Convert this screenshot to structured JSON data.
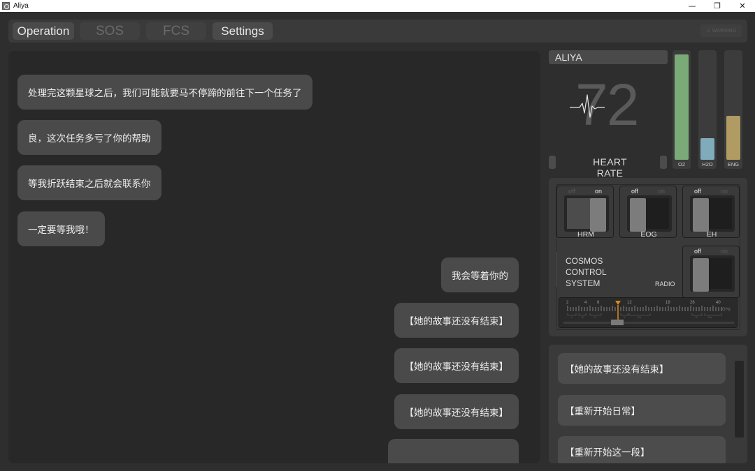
{
  "window": {
    "title": "Aliya",
    "controls": {
      "minimize": "—",
      "restore": "❐",
      "close": "✕"
    }
  },
  "toolbar": {
    "tabs": [
      {
        "label": "Operation",
        "state": "active"
      },
      {
        "label": "SOS",
        "state": "disabled"
      },
      {
        "label": "FCS",
        "state": "disabled"
      },
      {
        "label": "Settings",
        "state": "active"
      }
    ],
    "warning_badge": "⚠ WARNING"
  },
  "chat": {
    "messages": [
      {
        "from": "aliya",
        "text": "处理完这颗星球之后，我们可能就要马不停蹄的前往下一个任务了"
      },
      {
        "from": "aliya",
        "text": "良，这次任务多亏了你的帮助"
      },
      {
        "from": "aliya",
        "text": "等我折跃结束之后就会联系你"
      },
      {
        "from": "aliya",
        "text": "一定要等我哦！"
      },
      {
        "from": "player",
        "text": "我会等着你的"
      },
      {
        "from": "player",
        "text": "【她的故事还没有结束】"
      },
      {
        "from": "player",
        "text": "【她的故事还没有结束】"
      },
      {
        "from": "player",
        "text": "【她的故事还没有结束】"
      },
      {
        "from": "player",
        "text": ""
      }
    ]
  },
  "status": {
    "name": "ALIYA",
    "heart_rate_value": "72",
    "heart_rate_label": "HEART RATE",
    "gauges": [
      {
        "label": "O2",
        "level": 0.99,
        "color": "#7aaa78"
      },
      {
        "label": "H2O",
        "level": 0.2,
        "color": "#7fabbb"
      },
      {
        "label": "ENG",
        "level": 0.41,
        "color": "#b09b62"
      }
    ]
  },
  "control": {
    "switches": [
      {
        "name": "HRM",
        "off": "off",
        "on": "on",
        "state": "on"
      },
      {
        "name": "EOG",
        "off": "off",
        "on": "on",
        "state": "off"
      },
      {
        "name": "EH",
        "off": "off",
        "on": "on",
        "state": "off"
      }
    ],
    "cosmos_lines": [
      "COSMOS",
      "CONTROL",
      "SYSTEM"
    ],
    "radio": {
      "label": "RADIO",
      "off": "off",
      "on": "on",
      "state": "off"
    },
    "tuner": {
      "scale_labels": [
        "2",
        "4",
        "8",
        "12",
        "18",
        "26",
        "40"
      ],
      "unit": "GHz",
      "band_labels": [
        "L",
        "S",
        "C",
        "X",
        "Ku",
        "K",
        "Ka"
      ]
    }
  },
  "options": {
    "items": [
      "【她的故事还没有结束】",
      "【重新开始日常】",
      "【重新开始这一段】"
    ]
  }
}
